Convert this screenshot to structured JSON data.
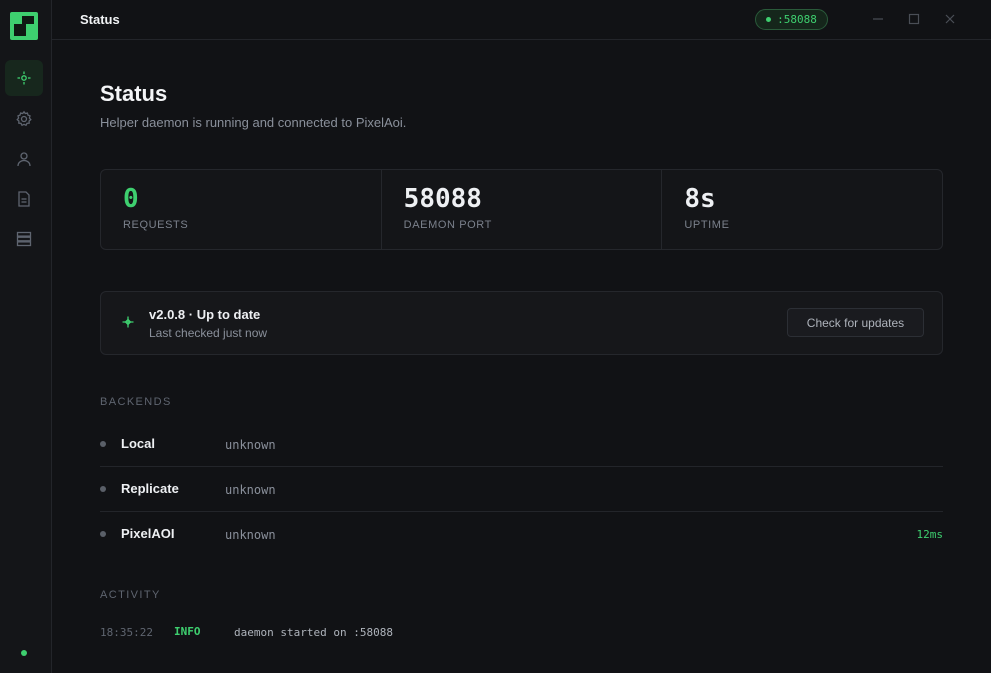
{
  "app": {
    "window_title": "Status",
    "port_badge": ":58088"
  },
  "sidebar": {
    "items": [
      {
        "name": "status",
        "icon": "crosshair-icon",
        "active": true
      },
      {
        "name": "settings",
        "icon": "gear-icon",
        "active": false
      },
      {
        "name": "account",
        "icon": "user-icon",
        "active": false
      },
      {
        "name": "logs",
        "icon": "document-icon",
        "active": false
      },
      {
        "name": "backends",
        "icon": "server-icon",
        "active": false
      }
    ],
    "status_indicator_color": "#3ecf6f"
  },
  "page": {
    "title": "Status",
    "subtitle": "Helper daemon is running and connected to PixelAoi."
  },
  "stats": [
    {
      "value": "0",
      "label": "REQUESTS",
      "accent": true
    },
    {
      "value": "58088",
      "label": "DAEMON PORT",
      "accent": false
    },
    {
      "value": "8s",
      "label": "UPTIME",
      "accent": false
    }
  ],
  "update": {
    "title": "v2.0.8 · Up to date",
    "subtitle": "Last checked just now",
    "button_label": "Check for updates"
  },
  "backends": {
    "section_label": "BACKENDS",
    "rows": [
      {
        "name": "Local",
        "status": "unknown",
        "latency": ""
      },
      {
        "name": "Replicate",
        "status": "unknown",
        "latency": ""
      },
      {
        "name": "PixelAOI",
        "status": "unknown",
        "latency": "12ms"
      }
    ]
  },
  "activity": {
    "section_label": "ACTIVITY",
    "entries": [
      {
        "time": "18:35:22",
        "level": "INFO",
        "message": "daemon started on :58088"
      }
    ]
  },
  "colors": {
    "accent": "#3ecf6f",
    "background": "#111215",
    "panel": "#141518"
  }
}
